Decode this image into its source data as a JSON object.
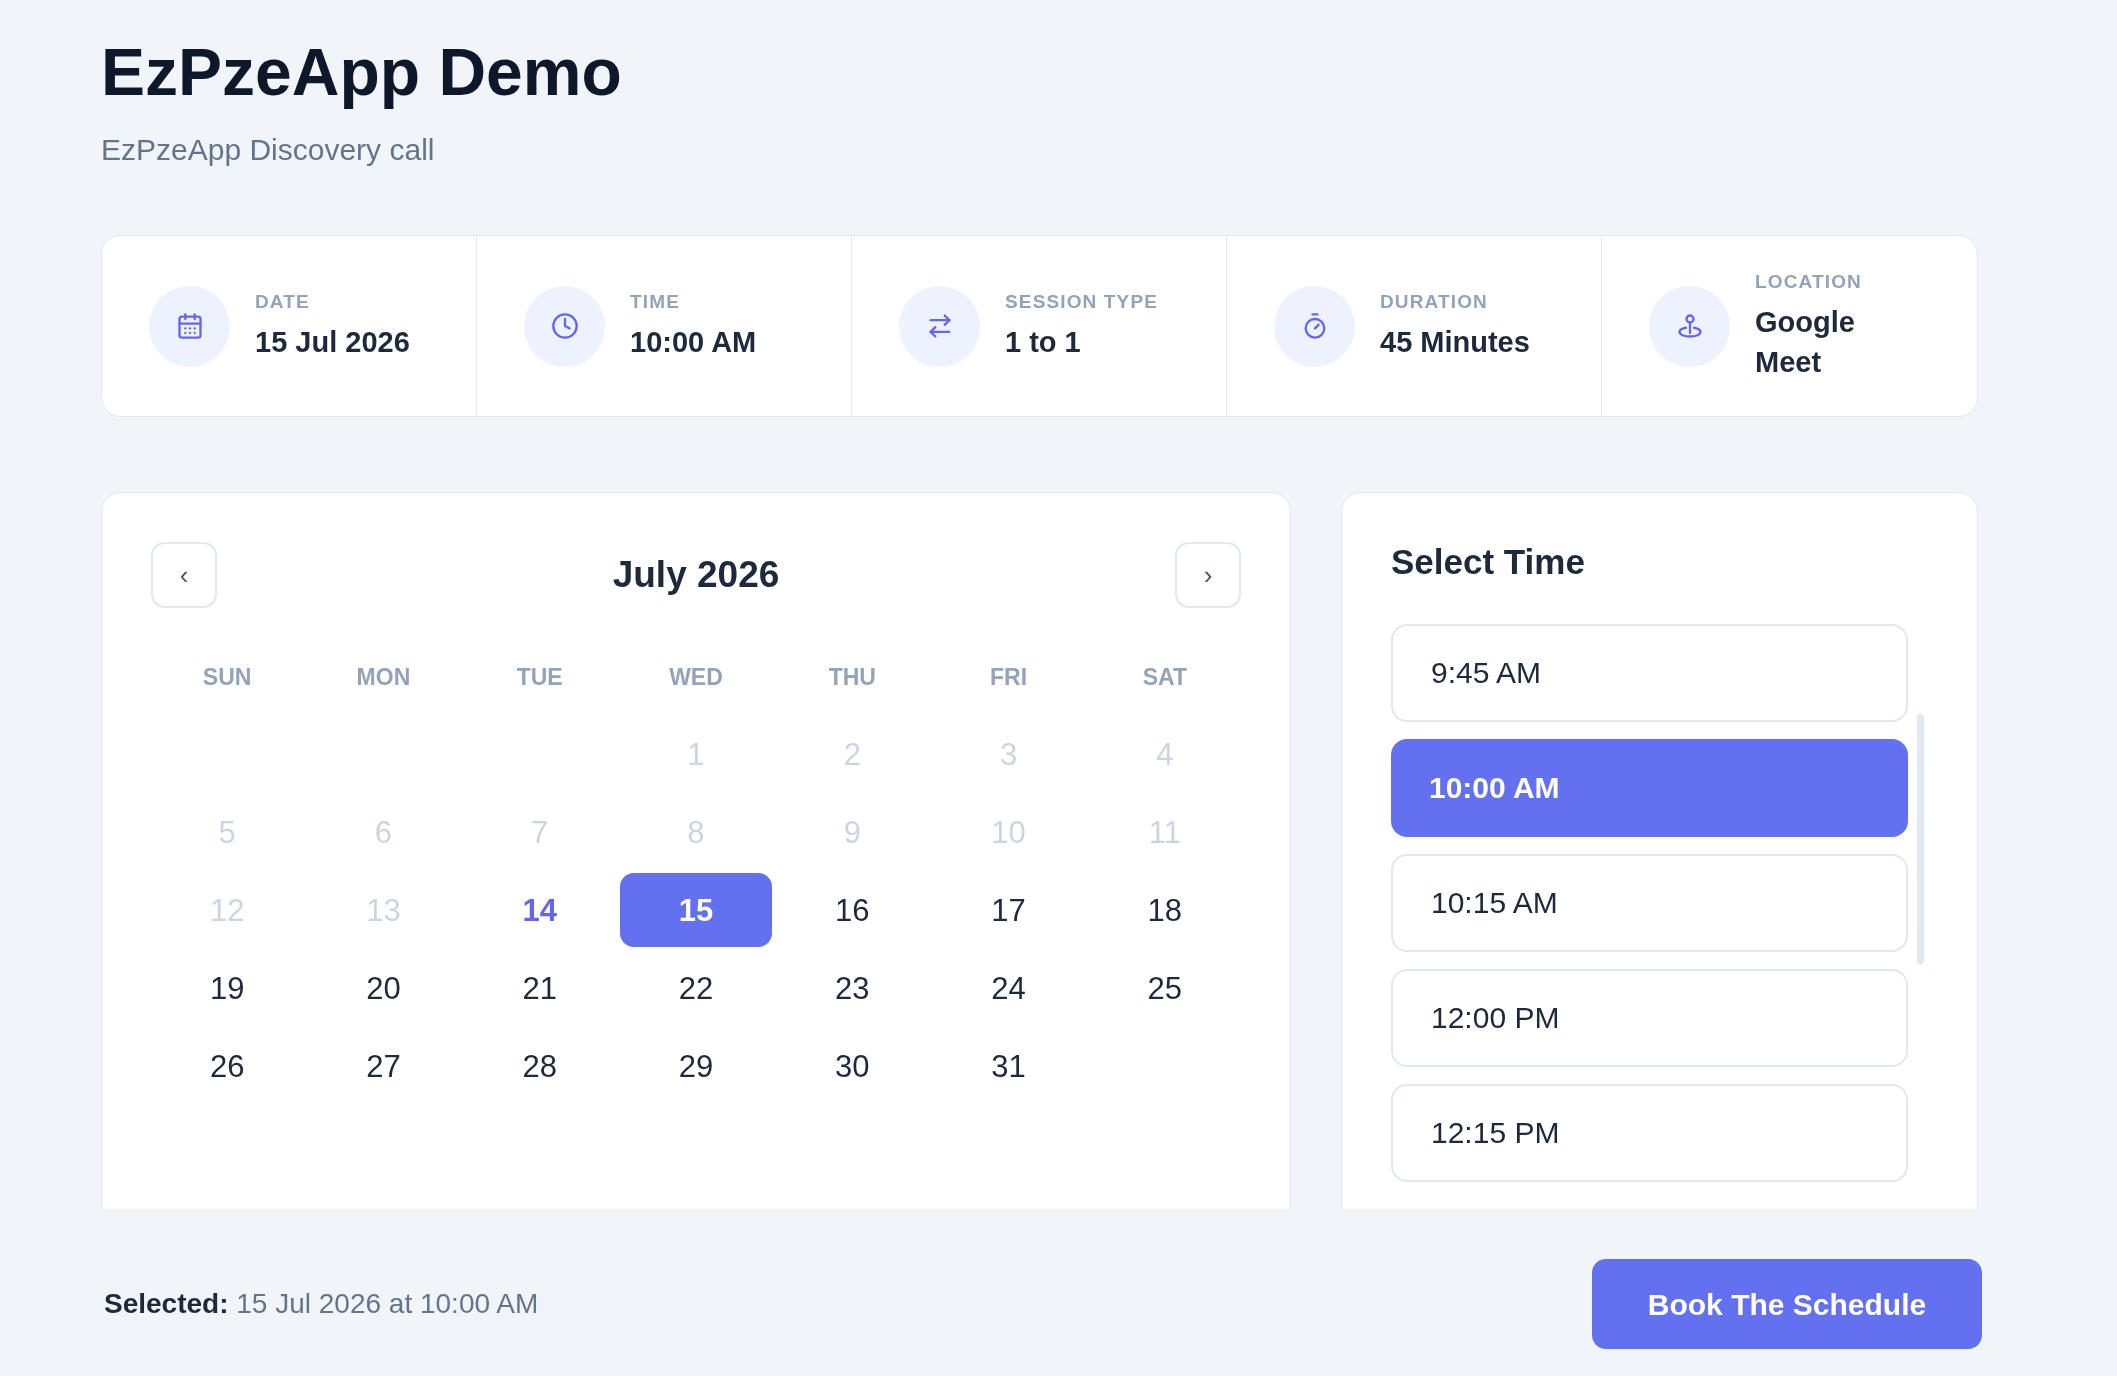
{
  "header": {
    "title": "EzPzeApp Demo",
    "subtitle": "EzPzeApp Discovery call"
  },
  "summary": [
    {
      "kind": "date",
      "label": "DATE",
      "value": "15 Jul 2026"
    },
    {
      "kind": "time",
      "label": "TIME",
      "value": "10:00 AM"
    },
    {
      "kind": "session",
      "label": "SESSION TYPE",
      "value": "1 to 1"
    },
    {
      "kind": "duration",
      "label": "DURATION",
      "value": "45 Minutes"
    },
    {
      "kind": "location",
      "label": "LOCATION",
      "value": "Google Meet"
    }
  ],
  "calendar": {
    "prev_button": "‹",
    "month": "July 2026",
    "next_button": "›",
    "weekdays": [
      "SUN",
      "MON",
      "TUE",
      "WED",
      "THU",
      "FRI",
      "SAT"
    ],
    "weeks": [
      [
        {
          "kind": "empty"
        },
        {
          "kind": "empty"
        },
        {
          "kind": "empty"
        },
        {
          "kind": "day",
          "label": "1",
          "disabled": true,
          "today": false,
          "selected": false
        },
        {
          "kind": "day",
          "label": "2",
          "disabled": true,
          "today": false,
          "selected": false
        },
        {
          "kind": "day",
          "label": "3",
          "disabled": true,
          "today": false,
          "selected": false
        },
        {
          "kind": "day",
          "label": "4",
          "disabled": true,
          "today": false,
          "selected": false
        }
      ],
      [
        {
          "kind": "day",
          "label": "5",
          "disabled": true,
          "today": false,
          "selected": false
        },
        {
          "kind": "day",
          "label": "6",
          "disabled": true,
          "today": false,
          "selected": false
        },
        {
          "kind": "day",
          "label": "7",
          "disabled": true,
          "today": false,
          "selected": false
        },
        {
          "kind": "day",
          "label": "8",
          "disabled": true,
          "today": false,
          "selected": false
        },
        {
          "kind": "day",
          "label": "9",
          "disabled": true,
          "today": false,
          "selected": false
        },
        {
          "kind": "day",
          "label": "10",
          "disabled": true,
          "today": false,
          "selected": false
        },
        {
          "kind": "day",
          "label": "11",
          "disabled": true,
          "today": false,
          "selected": false
        }
      ],
      [
        {
          "kind": "day",
          "label": "12",
          "disabled": true,
          "today": false,
          "selected": false
        },
        {
          "kind": "day",
          "label": "13",
          "disabled": true,
          "today": false,
          "selected": false
        },
        {
          "kind": "day",
          "label": "14",
          "disabled": false,
          "today": true,
          "selected": false
        },
        {
          "kind": "day",
          "label": "15",
          "disabled": false,
          "today": false,
          "selected": true
        },
        {
          "kind": "day",
          "label": "16",
          "disabled": false,
          "today": false,
          "selected": false
        },
        {
          "kind": "day",
          "label": "17",
          "disabled": false,
          "today": false,
          "selected": false
        },
        {
          "kind": "day",
          "label": "18",
          "disabled": false,
          "today": false,
          "selected": false
        }
      ],
      [
        {
          "kind": "day",
          "label": "19",
          "disabled": false,
          "today": false,
          "selected": false
        },
        {
          "kind": "day",
          "label": "20",
          "disabled": false,
          "today": false,
          "selected": false
        },
        {
          "kind": "day",
          "label": "21",
          "disabled": false,
          "today": false,
          "selected": false
        },
        {
          "kind": "day",
          "label": "22",
          "disabled": false,
          "today": false,
          "selected": false
        },
        {
          "kind": "day",
          "label": "23",
          "disabled": false,
          "today": false,
          "selected": false
        },
        {
          "kind": "day",
          "label": "24",
          "disabled": false,
          "today": false,
          "selected": false
        },
        {
          "kind": "day",
          "label": "25",
          "disabled": false,
          "today": false,
          "selected": false
        }
      ],
      [
        {
          "kind": "day",
          "label": "26",
          "disabled": false,
          "today": false,
          "selected": false
        },
        {
          "kind": "day",
          "label": "27",
          "disabled": false,
          "today": false,
          "selected": false
        },
        {
          "kind": "day",
          "label": "28",
          "disabled": false,
          "today": false,
          "selected": false
        },
        {
          "kind": "day",
          "label": "29",
          "disabled": false,
          "today": false,
          "selected": false
        },
        {
          "kind": "day",
          "label": "30",
          "disabled": false,
          "today": false,
          "selected": false
        },
        {
          "kind": "day",
          "label": "31",
          "disabled": false,
          "today": false,
          "selected": false
        },
        {
          "kind": "empty"
        }
      ]
    ]
  },
  "time_panel": {
    "title": "Select Time",
    "slots": [
      {
        "label": "9:45 AM",
        "selected": false
      },
      {
        "label": "10:00 AM",
        "selected": true
      },
      {
        "label": "10:15 AM",
        "selected": false
      },
      {
        "label": "12:00 PM",
        "selected": false
      },
      {
        "label": "12:15 PM",
        "selected": false
      }
    ]
  },
  "footer": {
    "selection": "**Selected:** 15 Jul 2026 at 10:00 AM",
    "book_button": "Book The Schedule"
  }
}
